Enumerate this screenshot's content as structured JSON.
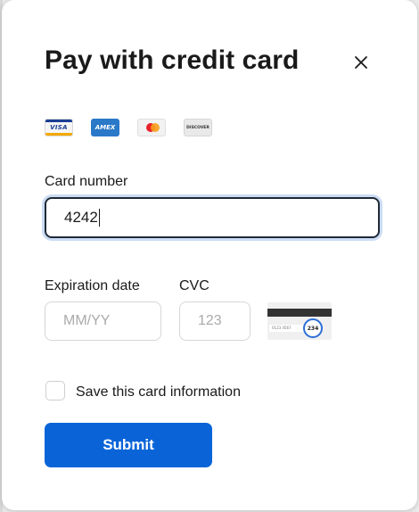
{
  "modal": {
    "title": "Pay with credit card",
    "close_icon": "close-icon"
  },
  "card_brands": [
    {
      "name": "visa",
      "text": "VISA"
    },
    {
      "name": "amex",
      "text": "AMEX"
    },
    {
      "name": "mastercard",
      "text": ""
    },
    {
      "name": "discover",
      "text": "DISCOVER"
    }
  ],
  "card_number": {
    "label": "Card number",
    "value": "4242"
  },
  "expiration": {
    "label": "Expiration date",
    "placeholder": "MM/YY"
  },
  "cvc": {
    "label": "CVC",
    "placeholder": "123",
    "illustration_code": "234",
    "illustration_sig": "0123 4567"
  },
  "save_card": {
    "label": "Save this card information",
    "checked": false
  },
  "submit": {
    "label": "Submit"
  },
  "colors": {
    "accent": "#0a64d8",
    "focus_ring": "#6a9bdc"
  }
}
